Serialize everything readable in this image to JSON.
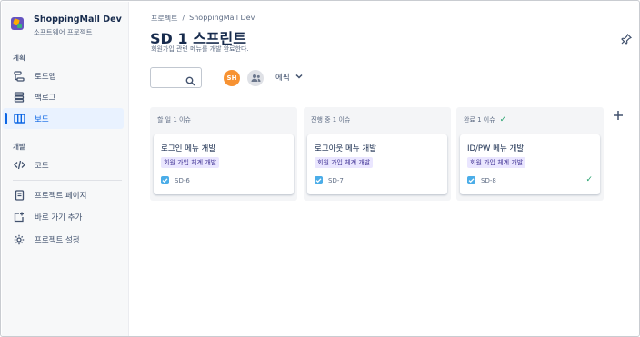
{
  "sidebar": {
    "project_name": "ShoppingMall Dev",
    "project_type": "소프트웨어 프로젝트",
    "planning_label": "계획",
    "dev_label": "개발",
    "items": [
      {
        "label": "로드맵",
        "icon": "roadmap-icon"
      },
      {
        "label": "백로그",
        "icon": "backlog-icon"
      },
      {
        "label": "보드",
        "icon": "board-icon"
      },
      {
        "label": "코드",
        "icon": "code-icon"
      },
      {
        "label": "프로젝트 페이지",
        "icon": "page-icon"
      },
      {
        "label": "바로 가기 추가",
        "icon": "add-shortcut-icon"
      },
      {
        "label": "프로젝트 설정",
        "icon": "gear-icon"
      }
    ]
  },
  "header": {
    "breadcrumb": [
      "프로젝트",
      "/",
      "ShoppingMall Dev"
    ],
    "title": "SD 1 스프린트",
    "sprint_goal": "회원가입 관련 메뉴를 개발 완료한다."
  },
  "toolbar": {
    "search_placeholder": "",
    "avatar_initials": "SH",
    "epic_filter": "에픽"
  },
  "board": {
    "columns": [
      {
        "title": "할 일 1 이슈",
        "done": false,
        "card": {
          "title": "로그인 메뉴 개발",
          "epic": "회원 가입 체계 개발",
          "key": "SD-6",
          "done": false
        }
      },
      {
        "title": "진행 중 1 이슈",
        "done": false,
        "card": {
          "title": "로그아웃 메뉴 개발",
          "epic": "회원 가입 체계 개발",
          "key": "SD-7",
          "done": false
        }
      },
      {
        "title": "완료 1 이슈",
        "done": true,
        "card": {
          "title": "ID/PW 메뉴 개발",
          "epic": "회원 가입 체계 개발",
          "key": "SD-8",
          "done": true
        }
      }
    ]
  },
  "colors": {
    "accent": "#0c66e4",
    "avatar": "#f79232",
    "epic_bg": "#eae6ff",
    "epic_text": "#403294",
    "done": "#22a06b"
  }
}
